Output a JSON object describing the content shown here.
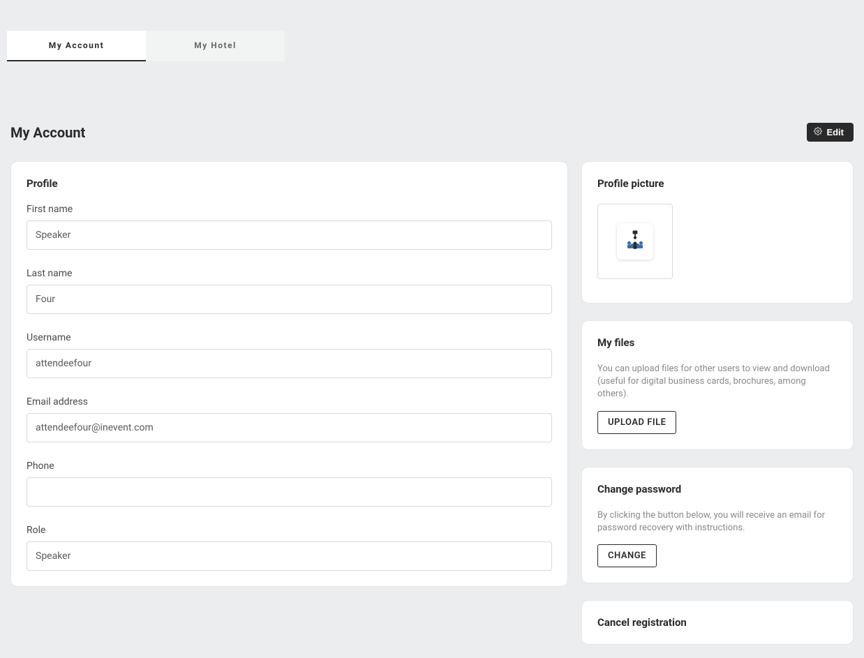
{
  "tabs": {
    "account": "My Account",
    "hotel": "My Hotel"
  },
  "header": {
    "title": "My Account",
    "edit_label": "Edit"
  },
  "profile": {
    "title": "Profile",
    "fields": {
      "first_name": {
        "label": "First name",
        "value": "Speaker"
      },
      "last_name": {
        "label": "Last name",
        "value": "Four"
      },
      "username": {
        "label": "Username",
        "value": "attendeefour"
      },
      "email": {
        "label": "Email address",
        "value": "attendeefour@inevent.com"
      },
      "phone": {
        "label": "Phone",
        "value": ""
      },
      "role": {
        "label": "Role",
        "value": "Speaker"
      }
    }
  },
  "profile_picture": {
    "title": "Profile picture"
  },
  "my_files": {
    "title": "My files",
    "desc": "You can upload files for other users to view and download (useful for digital business cards, brochures, among others).",
    "button_label": "UPLOAD FILE"
  },
  "change_password": {
    "title": "Change password",
    "desc": "By clicking the button below, you will receive an email for password recovery with instructions.",
    "button_label": "CHANGE"
  },
  "cancel_registration": {
    "title": "Cancel registration"
  }
}
